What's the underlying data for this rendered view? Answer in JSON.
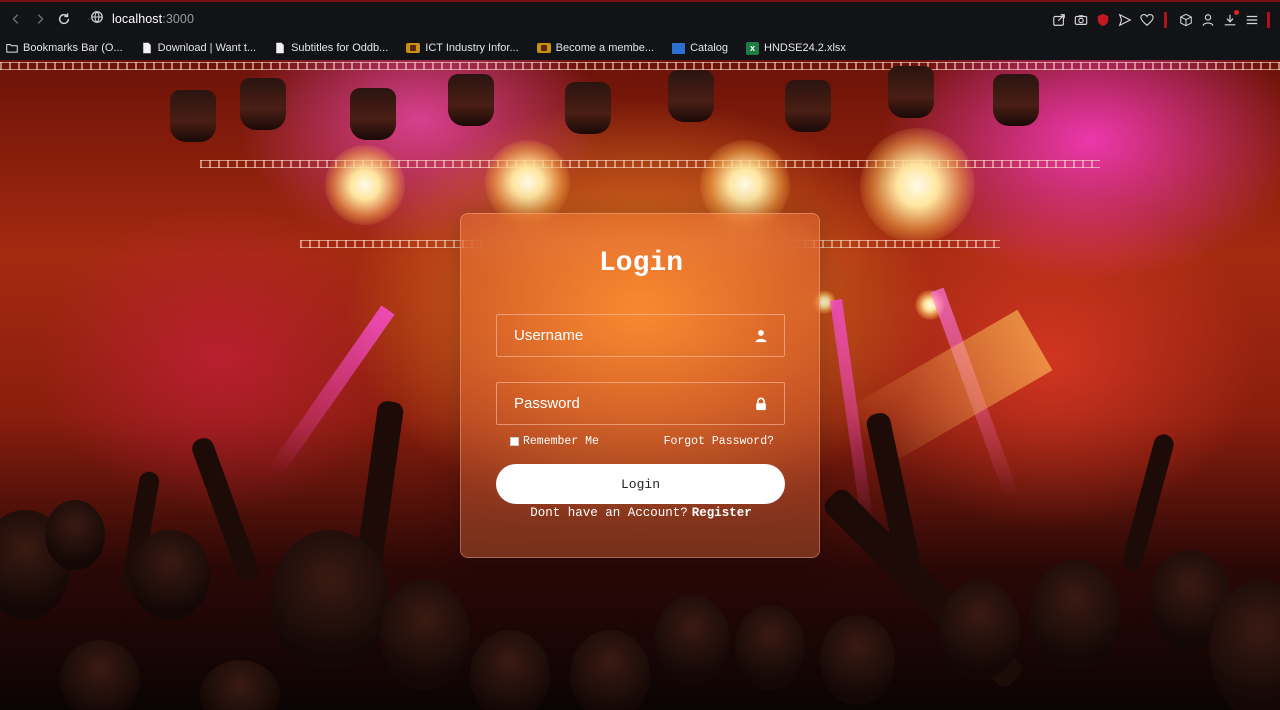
{
  "browser": {
    "url_host": "localhost",
    "url_port": ":3000",
    "nav_icons": [
      "back-icon",
      "forward-icon",
      "reload-icon",
      "site-info-icon"
    ],
    "toolbar_icons": [
      "share-icon",
      "screenshot-icon",
      "shield-icon",
      "send-icon",
      "heart-icon",
      "cube-icon",
      "profile-icon",
      "download-icon",
      "menu-icon"
    ],
    "accent_color": "#b0141a"
  },
  "bookmarks": [
    {
      "label": "Bookmarks Bar (O...",
      "icon": "folder-icon"
    },
    {
      "label": "Download | Want t...",
      "icon": "page-icon"
    },
    {
      "label": "Subtitles for Oddb...",
      "icon": "page-icon"
    },
    {
      "label": "ICT Industry Infor...",
      "icon": "gov-icon"
    },
    {
      "label": "Become a membe...",
      "icon": "gov-icon"
    },
    {
      "label": "Catalog",
      "icon": "ieee-icon"
    },
    {
      "label": "HNDSE24.2.xlsx",
      "icon": "excel-icon"
    }
  ],
  "login": {
    "title": "Login",
    "username_placeholder": "Username",
    "password_placeholder": "Password",
    "remember_label": "Remember Me",
    "forgot_label": "Forgot Password?",
    "submit_label": "Login",
    "register_prompt": "Dont have an Account?",
    "register_link": "Register"
  }
}
